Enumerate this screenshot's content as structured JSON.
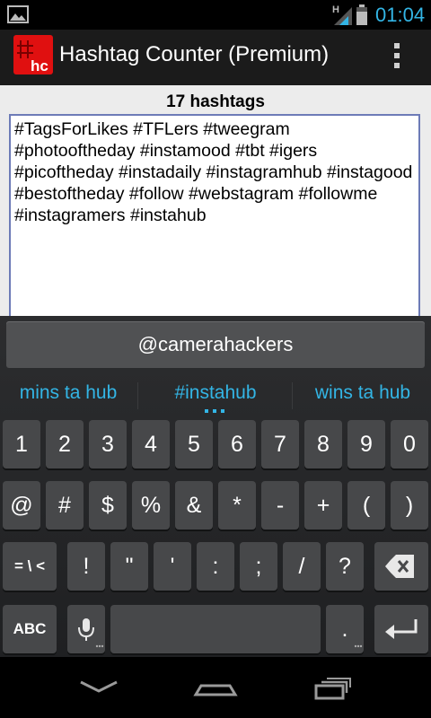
{
  "status": {
    "time": "01:04",
    "network_label": "H",
    "icons": [
      "gallery-icon",
      "signal-icon",
      "battery-icon"
    ],
    "accent_color": "#33b5e5"
  },
  "action_bar": {
    "title": "Hashtag Counter (Premium)",
    "app_icon": "hc-logo-icon",
    "app_icon_label": "hc",
    "menu_icon": "overflow-menu-icon"
  },
  "main": {
    "count_label": "17 hashtags",
    "text": "#TagsForLikes #TFLers #tweegram #photooftheday #instamood #tbt #igers #picoftheday #instadaily #instagramhub #instagood #bestoftheday #follow #webstagram #followme #instagramers #instahub"
  },
  "keyboard": {
    "suggestion_input": "@camerahackers",
    "candidates": [
      "mins ta hub",
      "#instahub",
      "wins ta hub"
    ],
    "rows": [
      [
        "1",
        "2",
        "3",
        "4",
        "5",
        "6",
        "7",
        "8",
        "9",
        "0"
      ],
      [
        "@",
        "#",
        "$",
        "%",
        "&",
        "*",
        "-",
        "+",
        "(",
        ")"
      ],
      [
        "= \\ <",
        "!",
        "\"",
        "'",
        ":",
        ";",
        "/",
        "?",
        "backspace"
      ],
      [
        "ABC",
        "mic",
        "space",
        ".",
        "enter"
      ]
    ],
    "labels": {
      "symbols_more": "= \\ <",
      "abc": "ABC",
      "period": "."
    }
  },
  "nav": {
    "buttons": [
      "back-icon",
      "home-icon",
      "recent-apps-icon"
    ]
  }
}
